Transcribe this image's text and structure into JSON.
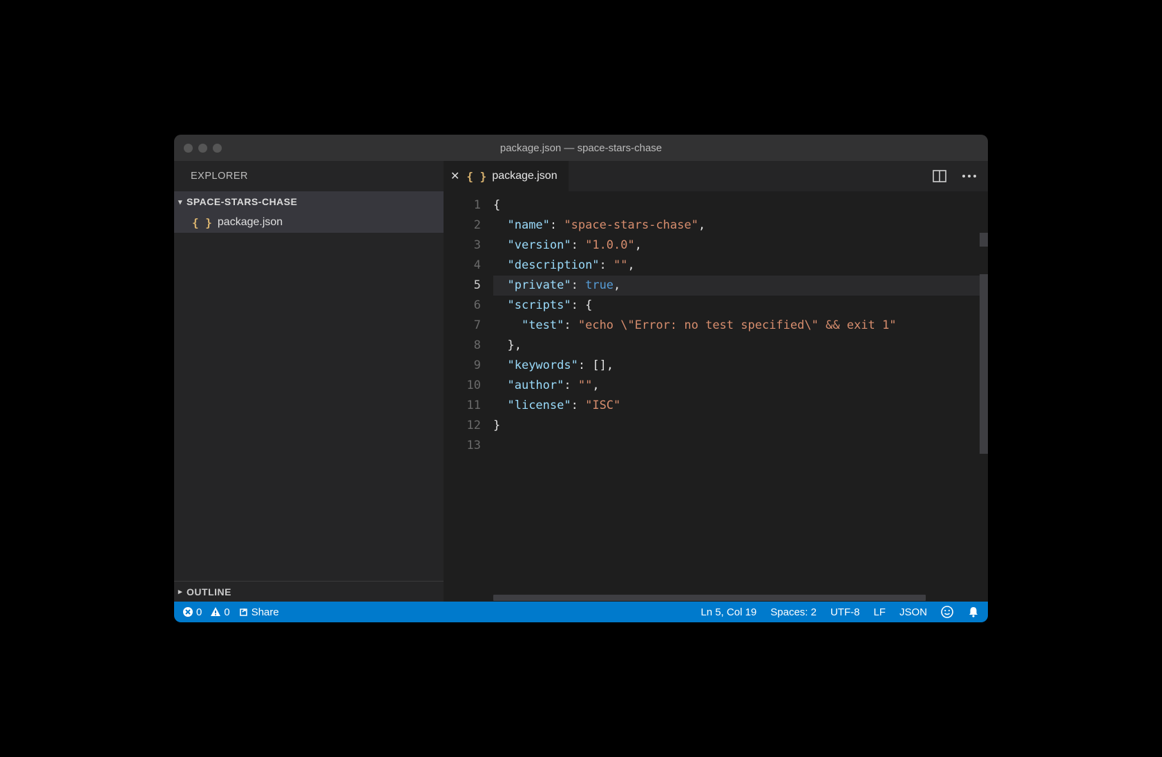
{
  "title": "package.json — space-stars-chase",
  "sidebar": {
    "title": "EXPLORER",
    "folder": "SPACE-STARS-CHASE",
    "files": [
      {
        "name": "package.json"
      }
    ],
    "outline": "OUTLINE"
  },
  "tab": {
    "name": "package.json"
  },
  "gutter": [
    "1",
    "2",
    "3",
    "4",
    "5",
    "6",
    "7",
    "8",
    "9",
    "10",
    "11",
    "12",
    "13"
  ],
  "active_line_index": 4,
  "code": {
    "l1": "{",
    "k_name": "\"name\"",
    "v_name": "\"space-stars-chase\"",
    "k_version": "\"version\"",
    "v_version": "\"1.0.0\"",
    "k_description": "\"description\"",
    "v_description": "\"\"",
    "k_private": "\"private\"",
    "v_private": "true",
    "k_scripts": "\"scripts\"",
    "k_test": "\"test\"",
    "v_test": "\"echo \\\"Error: no test specified\\\" && exit 1\"",
    "close_brace_comma": "},",
    "k_keywords": "\"keywords\"",
    "v_keywords": "[]",
    "k_author": "\"author\"",
    "v_author": "\"\"",
    "k_license": "\"license\"",
    "v_license": "\"ISC\"",
    "l12": "}"
  },
  "status": {
    "errors": "0",
    "warnings": "0",
    "share": "Share",
    "cursor": "Ln 5, Col 19",
    "spaces": "Spaces: 2",
    "encoding": "UTF-8",
    "eol": "LF",
    "language": "JSON"
  }
}
